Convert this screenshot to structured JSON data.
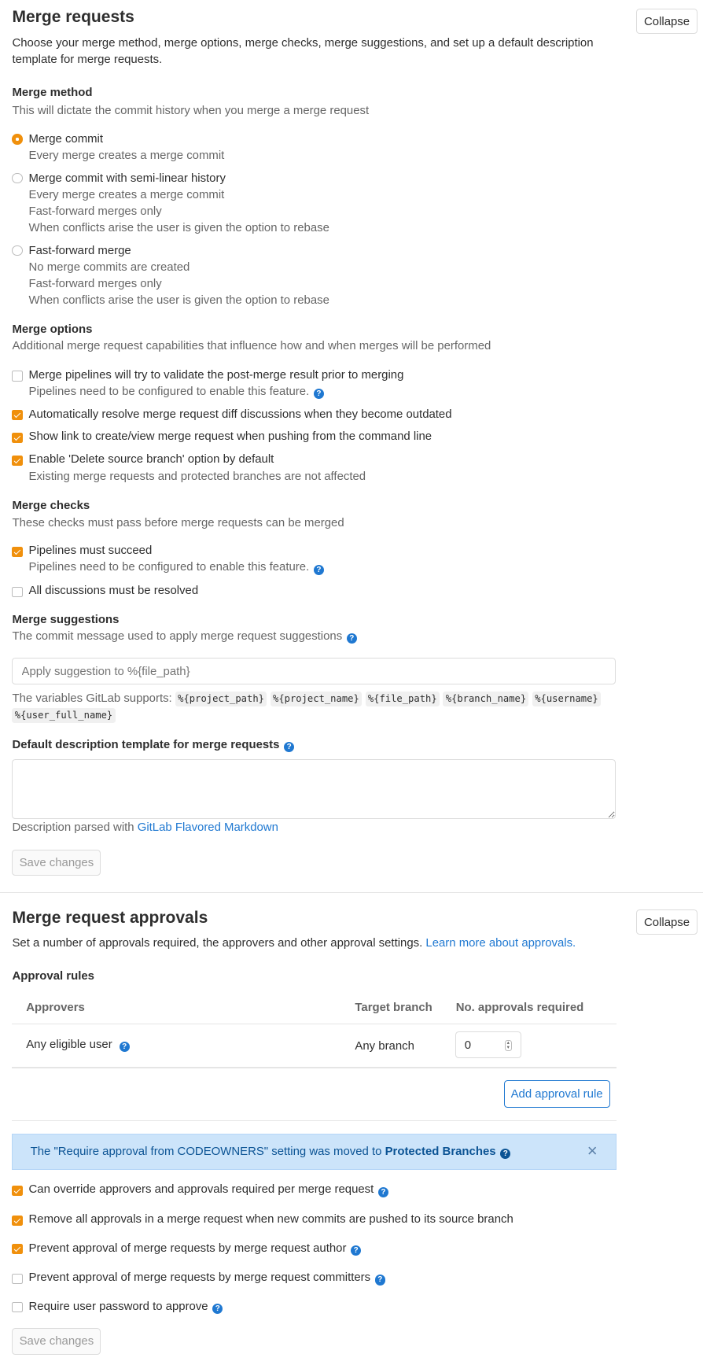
{
  "merge_requests": {
    "title": "Merge requests",
    "collapse_label": "Collapse",
    "description_line1": "Choose your merge method, merge options, merge checks, merge suggestions, and set up a default description",
    "description_line2": "template for merge requests.",
    "merge_method": {
      "title": "Merge method",
      "subtitle": "This will dictate the commit history when you merge a merge request",
      "options": [
        {
          "label": "Merge commit",
          "selected": true,
          "details": [
            "Every merge creates a merge commit"
          ]
        },
        {
          "label": "Merge commit with semi-linear history",
          "selected": false,
          "details": [
            "Every merge creates a merge commit",
            "Fast-forward merges only",
            "When conflicts arise the user is given the option to rebase"
          ]
        },
        {
          "label": "Fast-forward merge",
          "selected": false,
          "details": [
            "No merge commits are created",
            "Fast-forward merges only",
            "When conflicts arise the user is given the option to rebase"
          ]
        }
      ]
    },
    "merge_options": {
      "title": "Merge options",
      "subtitle": "Additional merge request capabilities that influence how and when merges will be performed",
      "items": [
        {
          "label": "Merge pipelines will try to validate the post-merge result prior to merging",
          "checked": false,
          "help": "Pipelines need to be configured to enable this feature."
        },
        {
          "label": "Automatically resolve merge request diff discussions when they become outdated",
          "checked": true
        },
        {
          "label": "Show link to create/view merge request when pushing from the command line",
          "checked": true
        },
        {
          "label": "Enable 'Delete source branch' option by default",
          "checked": true,
          "help": "Existing merge requests and protected branches are not affected"
        }
      ]
    },
    "merge_checks": {
      "title": "Merge checks",
      "subtitle": "These checks must pass before merge requests can be merged",
      "items": [
        {
          "label": "Pipelines must succeed",
          "checked": true,
          "help": "Pipelines need to be configured to enable this feature."
        },
        {
          "label": "All discussions must be resolved",
          "checked": false
        }
      ]
    },
    "merge_suggestions": {
      "title": "Merge suggestions",
      "subtitle": "The commit message used to apply merge request suggestions",
      "placeholder": "Apply suggestion to %{file_path}",
      "value": "",
      "variables_label": "The variables GitLab supports:",
      "variables": [
        "%{project_path}",
        "%{project_name}",
        "%{file_path}",
        "%{branch_name}",
        "%{username}",
        "%{user_full_name}"
      ]
    },
    "template": {
      "title": "Default description template for merge requests",
      "value": "",
      "parsed_prefix": "Description parsed with",
      "parsed_link": "GitLab Flavored Markdown"
    },
    "save_label": "Save changes"
  },
  "approvals": {
    "title": "Merge request approvals",
    "collapse_label": "Collapse",
    "description": "Set a number of approvals required, the approvers and other approval settings.",
    "learn_more": "Learn more about approvals.",
    "rules_title": "Approval rules",
    "table": {
      "headers": [
        "Approvers",
        "Target branch",
        "No. approvals required"
      ],
      "rows": [
        {
          "approvers": "Any eligible user",
          "target_branch": "Any branch",
          "approvals_required": "0"
        }
      ]
    },
    "add_rule_label": "Add approval rule",
    "alert": {
      "text": "The \"Require approval from CODEOWNERS\" setting was moved to",
      "link": "Protected Branches",
      "close": "×"
    },
    "settings": [
      {
        "label": "Can override approvers and approvals required per merge request",
        "checked": true
      },
      {
        "label": "Remove all approvals in a merge request when new commits are pushed to its source branch",
        "checked": true
      },
      {
        "label": "Prevent approval of merge requests by merge request author",
        "checked": true
      },
      {
        "label": "Prevent approval of merge requests by merge request committers",
        "checked": false
      },
      {
        "label": "Require user password to approve",
        "checked": false
      }
    ],
    "save_label": "Save changes"
  },
  "help_icon_glyph": "?",
  "colors": {
    "accent": "#f0900c",
    "link": "#1f78d1",
    "alert_bg": "#cce4fa"
  }
}
